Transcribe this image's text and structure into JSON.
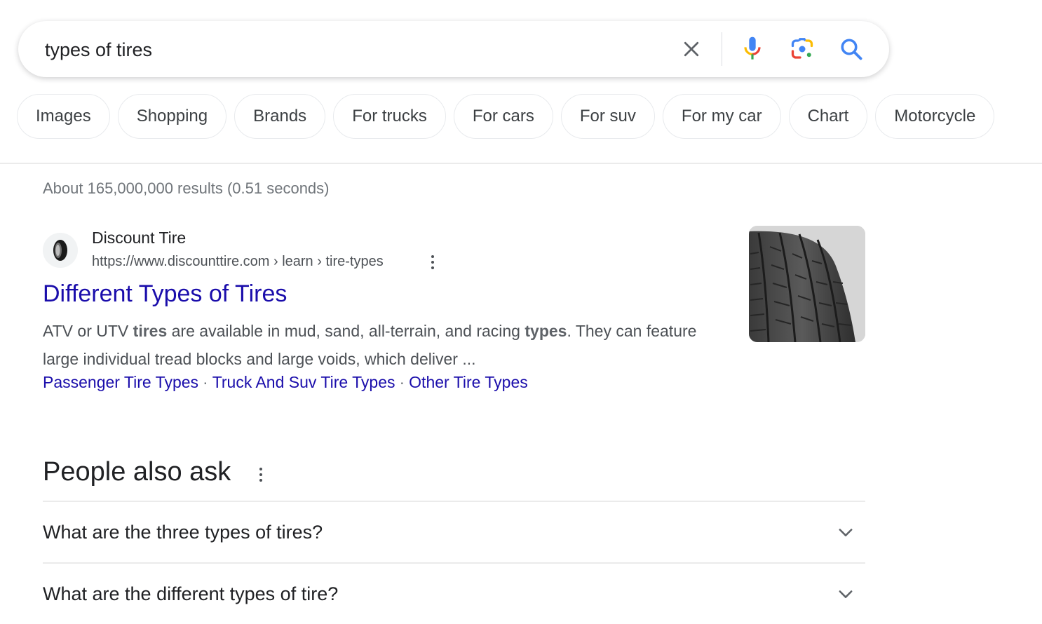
{
  "search": {
    "query": "types of tires",
    "icons": {
      "clear": "close-icon",
      "voice": "microphone-icon",
      "lens": "camera-lens-icon",
      "submit": "search-icon"
    }
  },
  "chips": [
    {
      "label": "Images"
    },
    {
      "label": "Shopping"
    },
    {
      "label": "Brands"
    },
    {
      "label": "For trucks"
    },
    {
      "label": "For cars"
    },
    {
      "label": "For suv"
    },
    {
      "label": "For my car"
    },
    {
      "label": "Chart"
    },
    {
      "label": "Motorcycle"
    }
  ],
  "stats": "About 165,000,000 results (0.51 seconds)",
  "result": {
    "site_name": "Discount Tire",
    "url": "https://www.discounttire.com › learn › tire-types",
    "title": "Different Types of Tires",
    "snippet_parts": [
      {
        "text": "ATV or UTV ",
        "bold": false
      },
      {
        "text": "tires",
        "bold": true
      },
      {
        "text": " are available in mud, sand, all-terrain, and racing ",
        "bold": false
      },
      {
        "text": "types",
        "bold": true
      },
      {
        "text": ". They can feature large individual tread blocks and large voids, which deliver ...",
        "bold": false
      }
    ],
    "sitelinks": [
      {
        "label": "Passenger Tire Types"
      },
      {
        "label": "Truck And Suv Tire Types"
      },
      {
        "label": "Other Tire Types"
      }
    ],
    "sitelink_separator": "·",
    "favicon": "tire-icon",
    "thumbnail": "tire-tread-image"
  },
  "people_also_ask": {
    "title": "People also ask",
    "questions": [
      {
        "text": "What are the three types of tires?"
      },
      {
        "text": "What are the different types of tire?"
      }
    ]
  },
  "colors": {
    "link": "#1a0dab",
    "text": "#202124",
    "muted": "#70757a",
    "snippet": "#4d5156",
    "google_blue": "#4285f4",
    "google_red": "#ea4335",
    "google_yellow": "#fbbc04",
    "google_green": "#34a853"
  }
}
